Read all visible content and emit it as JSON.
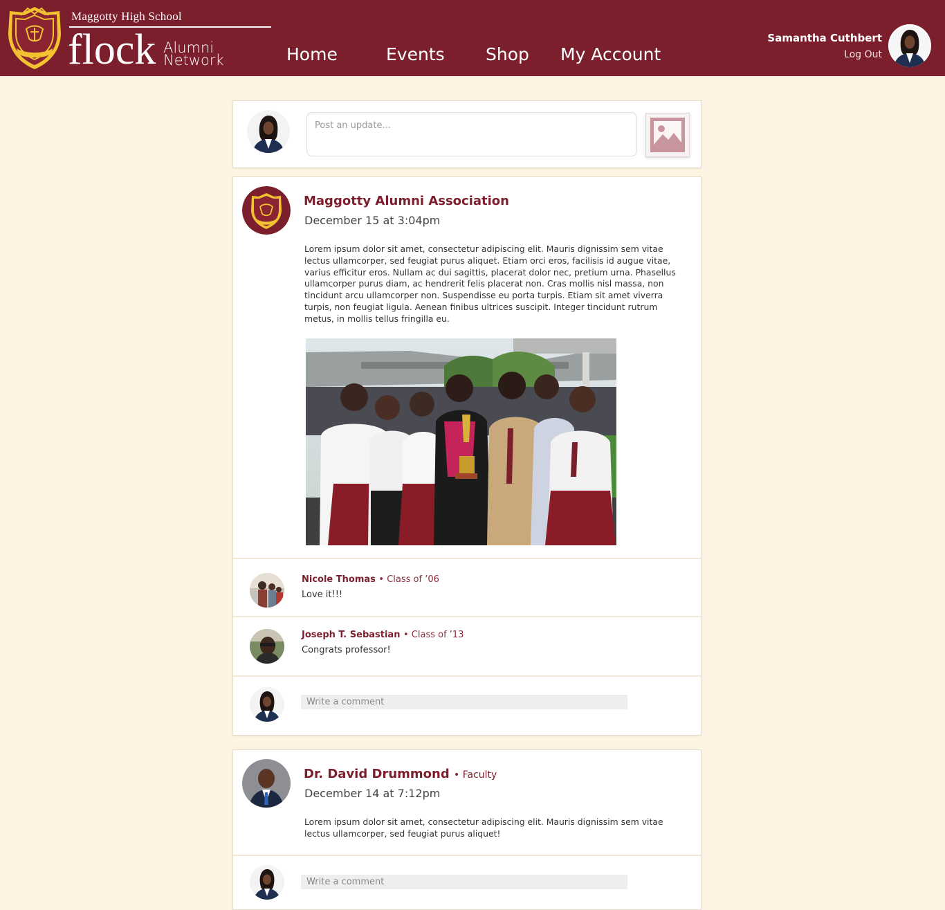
{
  "colors": {
    "brand": "#7b1f2d",
    "page_background": "#fdf3e3",
    "crest_gold": "#f2c230"
  },
  "header": {
    "school_name": "Maggotty High School",
    "brand_name": "flock",
    "brand_tagline_1": "Alumni",
    "brand_tagline_2": "Network",
    "crest_icon": "school-crest-icon",
    "nav": [
      {
        "label": "Home"
      },
      {
        "label": "Events"
      },
      {
        "label": "Shop"
      },
      {
        "label": "My Account"
      }
    ],
    "user": {
      "name": "Samantha Cuthbert",
      "logout_label": "Log Out"
    }
  },
  "composer": {
    "placeholder": "Post an update...",
    "image_icon": "image-icon"
  },
  "posts": [
    {
      "author": "Maggotty Alumni Association",
      "timestamp": "December 15 at 3:04pm",
      "body": "Lorem ipsum dolor sit amet, consectetur adipiscing elit. Mauris dignissim sem vitae lectus ullamcorper, sed feugiat purus aliquet. Etiam orci eros, facilisis id augue vitae, varius efficitur eros. Nullam ac dui sagittis, placerat dolor nec, pretium urna. Phasellus ullamcorper purus diam, ac hendrerit felis placerat non. Cras mollis nisl massa, non tincidunt arcu ullamcorper non. Suspendisse eu porta turpis. Etiam sit amet viverra turpis, non feugiat ligula. Aenean finibus ultrices suscipit. Integer tincidunt rutrum metus, in mollis tellus fringilla eu.",
      "comments": [
        {
          "name": "Nicole Thomas",
          "class": "• Class of ’06",
          "text": "Love it!!!"
        },
        {
          "name": "Joseph T. Sebastian",
          "class": "• Class of ’13",
          "text": "Congrats professor!"
        }
      ],
      "comment_placeholder": "Write a comment"
    },
    {
      "author": "Dr. David Drummond",
      "role": "• Faculty",
      "timestamp": "December 14 at 7:12pm",
      "body": "Lorem ipsum dolor sit amet, consectetur adipiscing elit. Mauris dignissim sem vitae lectus ullamcorper, sed feugiat purus aliquet!",
      "comment_placeholder": "Write a comment"
    }
  ]
}
